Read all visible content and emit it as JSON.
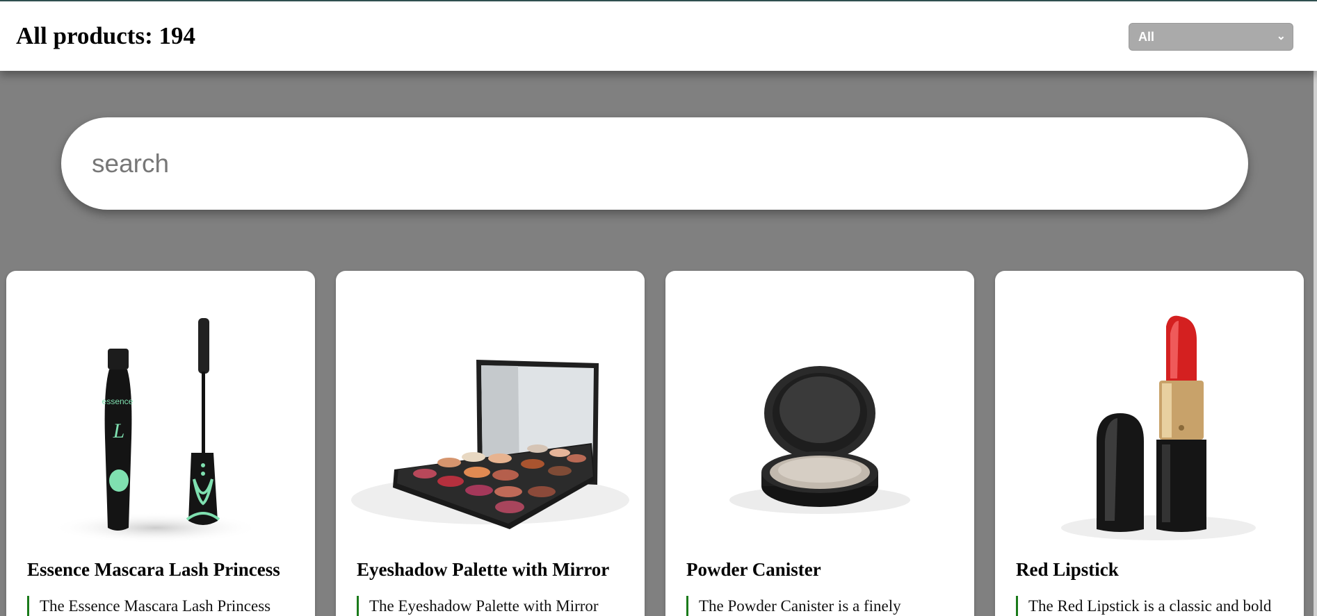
{
  "header": {
    "title": "All products: 194",
    "filter": {
      "selected": "All"
    }
  },
  "search": {
    "placeholder": "search",
    "value": ""
  },
  "products": [
    {
      "name": "Essence Mascara Lash Princess",
      "description": "The Essence Mascara Lash Princess",
      "brand_text": "essence",
      "image_icon": "mascara-icon"
    },
    {
      "name": "Eyeshadow Palette with Mirror",
      "description": "The Eyeshadow Palette with Mirror",
      "image_icon": "palette-icon"
    },
    {
      "name": "Powder Canister",
      "description": "The Powder Canister is a finely",
      "image_icon": "compact-icon"
    },
    {
      "name": "Red Lipstick",
      "description": "The Red Lipstick is a classic and bold",
      "image_icon": "lipstick-icon"
    }
  ],
  "colors": {
    "accent": "#1a7a1a",
    "background": "#808080",
    "lipstick": "#d42020"
  }
}
